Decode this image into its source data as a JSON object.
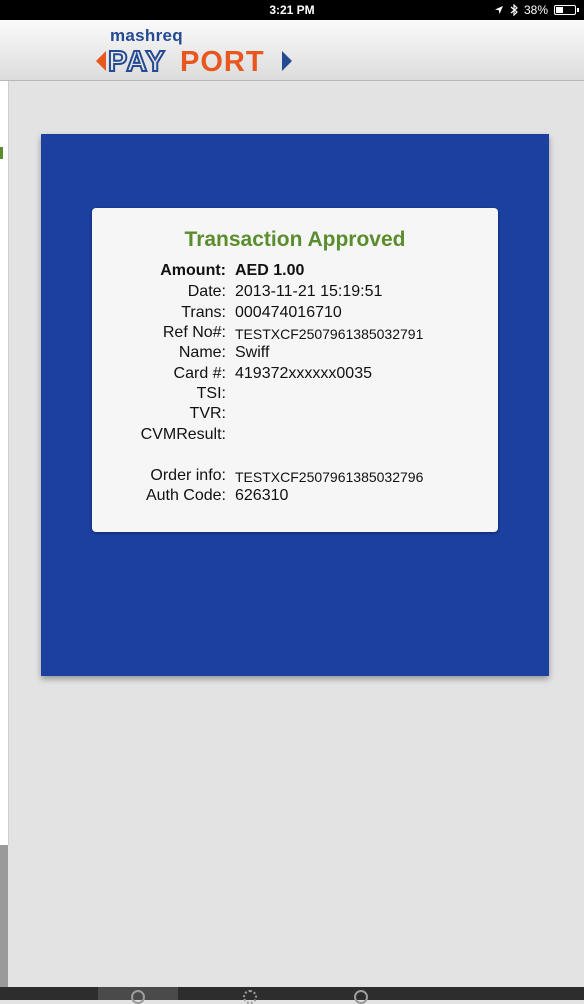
{
  "status_bar": {
    "time": "3:21 PM",
    "battery": "38%",
    "icons": [
      "location-arrow-icon",
      "bluetooth-icon",
      "battery-icon"
    ]
  },
  "header": {
    "brand_top": "mashreq",
    "brand_main": "PAYPORT"
  },
  "receipt": {
    "title": "Transaction Approved",
    "fields": {
      "amount": {
        "label": "Amount:",
        "value": "AED 1.00"
      },
      "date": {
        "label": "Date:",
        "value": "2013-11-21 15:19:51"
      },
      "trans": {
        "label": "Trans:",
        "value": "000474016710"
      },
      "ref": {
        "label": "Ref No#:",
        "value": "TESTXCF2507961385032791"
      },
      "name": {
        "label": "Name:",
        "value": "Swiff"
      },
      "card": {
        "label": "Card #:",
        "value": "419372xxxxxx0035"
      },
      "tsi": {
        "label": "TSI:",
        "value": ""
      },
      "tvr": {
        "label": "TVR:",
        "value": ""
      },
      "cvm": {
        "label": "CVMResult:",
        "value": ""
      },
      "order": {
        "label": "Order info:",
        "value": "TESTXCF2507961385032796"
      },
      "auth": {
        "label": "Auth Code:",
        "value": "626310"
      }
    }
  },
  "colors": {
    "panel_blue": "#1b40a0",
    "approved_green": "#5a8d2d",
    "brand_blue": "#244a93",
    "brand_orange": "#e8571e"
  }
}
